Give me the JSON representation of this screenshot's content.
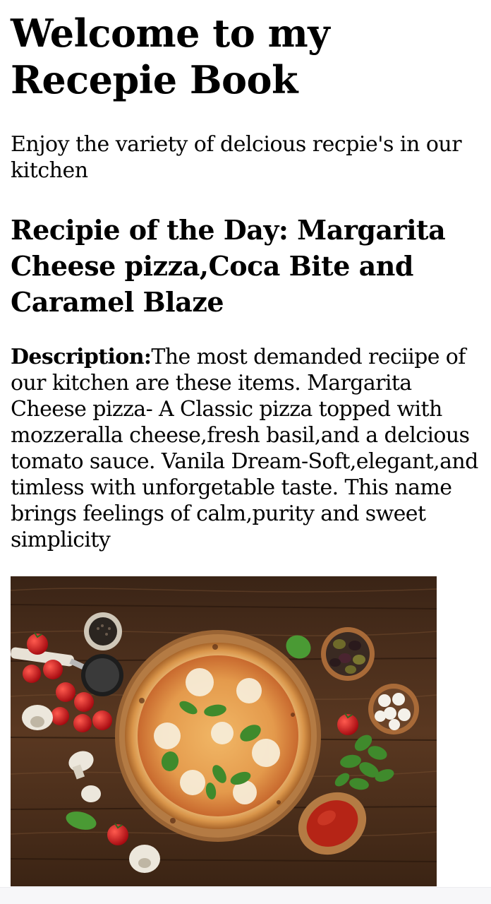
{
  "header": {
    "title": "Welcome to my Recepie Book"
  },
  "intro": {
    "text": "Enjoy the variety of delcious recpie's in our kitchen"
  },
  "recipe_of_day": {
    "heading": "Recipie of the Day: Margarita Cheese pizza,Coca Bite and Caramel Blaze",
    "description_label": "Description:",
    "description_text": "The most demanded reciipe of our kitchen are these items. Margarita Cheese pizza- A Classic pizza topped with mozzeralla cheese,fresh basil,and a delcious tomato sauce. Vanila Dream-Soft,elegant,and timless with unforgetable taste. This name brings feelings of calm,purity and sweet simplicity"
  },
  "photo": {
    "subject": "margherita-pizza-photo",
    "colors": {
      "wood": "#4a2e1c",
      "crust": "#e3a45a",
      "sauce": "#c9622e",
      "basil": "#3f8a2c",
      "tomato": "#c4121a"
    }
  }
}
